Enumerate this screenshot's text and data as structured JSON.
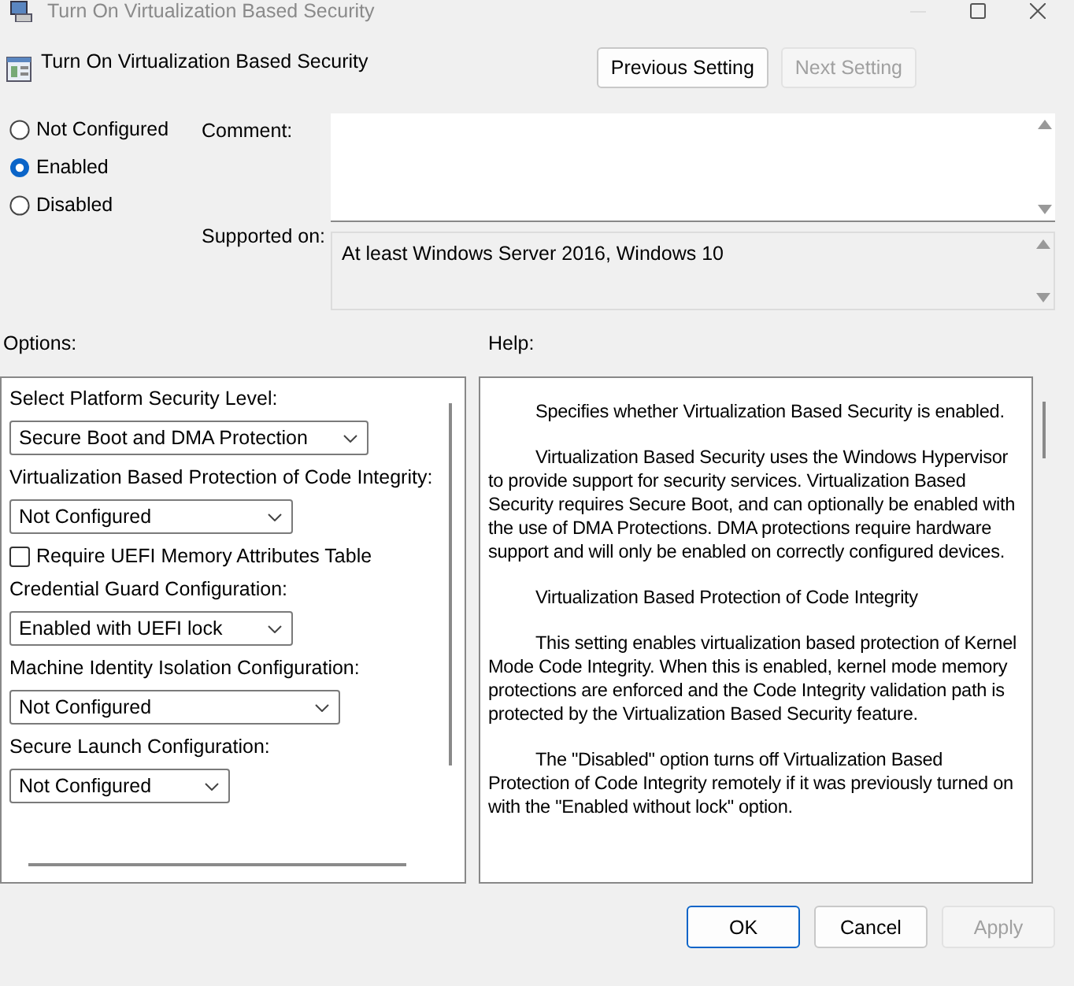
{
  "window": {
    "title": "Turn On Virtualization Based Security"
  },
  "header": {
    "title": "Turn On Virtualization Based Security",
    "buttons": [
      {
        "label": "Previous Setting",
        "disabled": false
      },
      {
        "label": "Next Setting",
        "disabled": true
      }
    ]
  },
  "state_options": [
    {
      "label": "Not Configured",
      "selected": false
    },
    {
      "label": "Enabled",
      "selected": true
    },
    {
      "label": "Disabled",
      "selected": false
    }
  ],
  "comment": {
    "label": "Comment:"
  },
  "supported_on": {
    "label": "Supported on:",
    "value": "At least Windows Server 2016, Windows 10"
  },
  "options": {
    "label": "Options:",
    "items": [
      {
        "kind": "label",
        "text": "Select Platform Security Level:"
      },
      {
        "kind": "dropdown",
        "text": "Secure Boot and DMA Protection"
      },
      {
        "kind": "label",
        "text": "Virtualization Based Protection of Code Integrity:"
      },
      {
        "kind": "dropdown",
        "text": "Not Configured"
      },
      {
        "kind": "checkbox",
        "text": "Require UEFI Memory Attributes Table",
        "checked": false
      },
      {
        "kind": "label",
        "text": "Credential Guard Configuration:"
      },
      {
        "kind": "dropdown",
        "text": "Enabled with UEFI lock"
      },
      {
        "kind": "label",
        "text": "Machine Identity Isolation Configuration:"
      },
      {
        "kind": "dropdown",
        "text": "Not Configured"
      },
      {
        "kind": "label",
        "text": "Secure Launch Configuration:"
      },
      {
        "kind": "dropdown",
        "text": "Not Configured"
      }
    ]
  },
  "help": {
    "label": "Help:",
    "paragraphs": [
      "Specifies whether Virtualization Based Security is enabled.",
      "Virtualization Based Security uses the Windows Hypervisor to provide support for security services. Virtualization Based Security requires Secure Boot, and can optionally be enabled with the use of DMA Protections. DMA protections require hardware support and will only be enabled on correctly configured devices.",
      "Virtualization Based Protection of Code Integrity",
      "This setting enables virtualization based protection of Kernel Mode Code Integrity. When this is enabled, kernel mode memory protections are enforced and the Code Integrity validation path is protected by the Virtualization Based Security feature.",
      "The \"Disabled\" option turns off Virtualization Based Protection of Code Integrity remotely if it was previously turned on with the \"Enabled without lock\" option."
    ]
  },
  "buttons": [
    {
      "label": "OK",
      "kind": "default",
      "disabled": false
    },
    {
      "label": "Cancel",
      "kind": "normal",
      "disabled": false
    },
    {
      "label": "Apply",
      "kind": "normal",
      "disabled": true
    }
  ]
}
